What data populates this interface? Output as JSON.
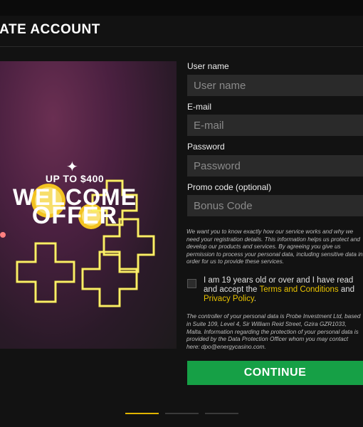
{
  "header": {
    "title": "EATE ACCOUNT"
  },
  "promo": {
    "upto": "UP TO $400",
    "line1": "WELCOME",
    "line2": "OFFER",
    "sparkle_icon": "sparkle-icon"
  },
  "form": {
    "username": {
      "label": "User name",
      "placeholder": "User name"
    },
    "email": {
      "label": "E-mail",
      "placeholder": "E-mail"
    },
    "password": {
      "label": "Password",
      "placeholder": "Password"
    },
    "promo": {
      "label": "Promo code (optional)",
      "placeholder": "Bonus Code"
    },
    "privacy_notice": "We want you to know exactly how our service works and why we need your registration details. This information helps us protect and develop our products and services. By agreeing you give us permission to process your personal data, including sensitive data in order for us to provide these services.",
    "age_text_pre": "I am 19 years old or over and I have read and accept the",
    "terms_link": "Terms and Conditions",
    "and_text": "and",
    "privacy_link": "Privacy Policy",
    "period": ".",
    "controller_notice": "The controller of your personal data is Probe Investment Ltd, based in Suite 109, Level 4, Sir William Reid Street, Gzira GZR1033, Malta. Information regarding the protection of your personal data is provided by the Data Protection Officer whom you may contact here: dpo@energycasino.com.",
    "continue_label": "CONTINUE"
  },
  "progress": {
    "current_step": 1,
    "total_steps": 3
  },
  "colors": {
    "accent": "#e0b400",
    "button": "#16a046",
    "link": "#e8c200"
  }
}
